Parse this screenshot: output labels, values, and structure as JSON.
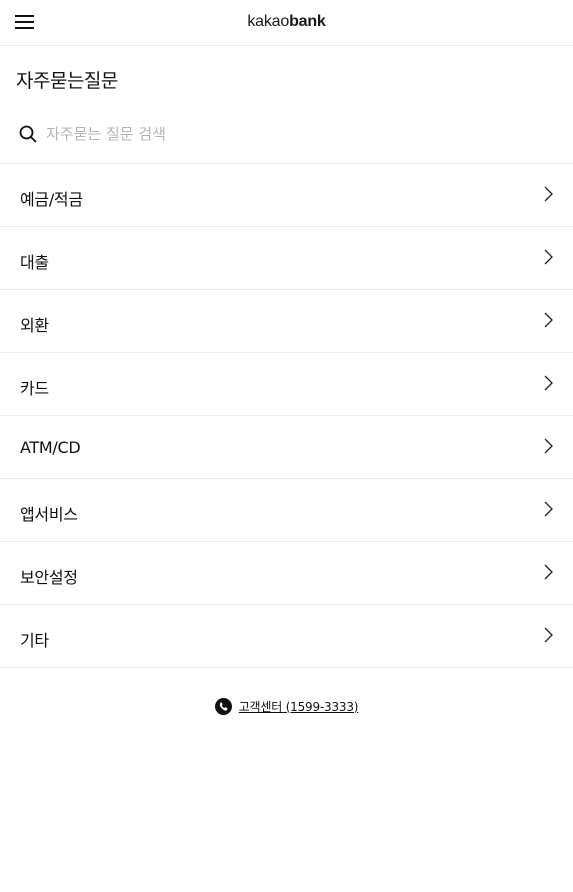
{
  "header": {
    "logo_light": "kakao",
    "logo_bold": "bank"
  },
  "page": {
    "title": "자주묻는질문"
  },
  "search": {
    "placeholder": "자주묻는 질문 검색",
    "value": ""
  },
  "categories": [
    {
      "label": "예금/적금"
    },
    {
      "label": "대출"
    },
    {
      "label": "외환"
    },
    {
      "label": "카드"
    },
    {
      "label": "ATM/CD"
    },
    {
      "label": "앱서비스"
    },
    {
      "label": "보안설정"
    },
    {
      "label": "기타"
    }
  ],
  "customer_center": {
    "label": "고객센터 (1599-3333)"
  },
  "icons": {
    "menu": "hamburger-menu-icon",
    "search": "search-icon",
    "chevron": "chevron-right-icon",
    "phone": "phone-icon"
  },
  "colors": {
    "text": "#111111",
    "divider": "#ececec",
    "placeholder": "#b4b4b4",
    "background": "#ffffff"
  }
}
